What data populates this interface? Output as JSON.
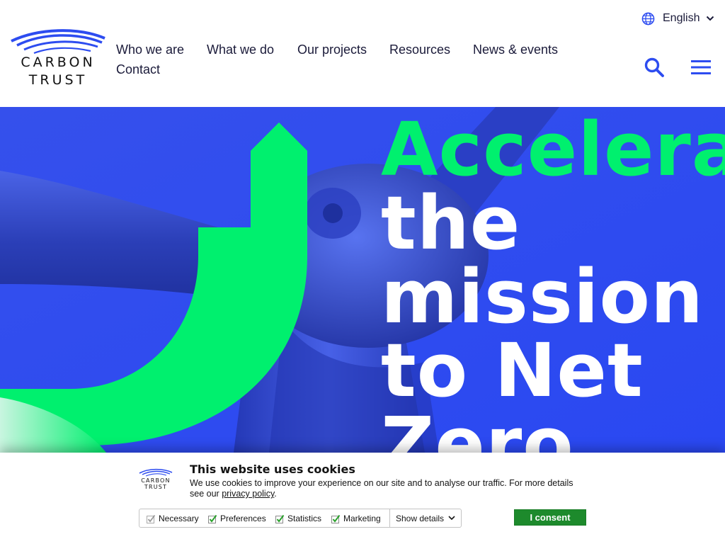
{
  "header": {
    "logo": {
      "line1": "CARBON",
      "line2": "TRUST"
    },
    "nav": [
      {
        "label": "Who we are"
      },
      {
        "label": "What we do"
      },
      {
        "label": "Our projects"
      },
      {
        "label": "Resources"
      },
      {
        "label": "News & events"
      },
      {
        "label": "Contact"
      }
    ],
    "language": {
      "label": "English",
      "icon": "globe-icon"
    },
    "search_icon": "search-icon",
    "menu_icon": "hamburger-menu-icon"
  },
  "hero": {
    "headline": {
      "line1": "Accelerating",
      "line2": "the",
      "line3": "mission",
      "line4": "to Net",
      "line5": "Zero"
    },
    "colors": {
      "background": "#2d4cf0",
      "accent": "#00f06e",
      "text": "#ffffff"
    }
  },
  "cookie_banner": {
    "logo": {
      "line1": "CARBON",
      "line2": "TRUST"
    },
    "title": "This website uses cookies",
    "text": "We use cookies to improve your experience on our site and to analyse our traffic. For more details see our",
    "link": "privacy policy",
    "text_end": ".",
    "checkboxes": [
      {
        "label": "Necessary",
        "checked": true,
        "disabled": true
      },
      {
        "label": "Preferences",
        "checked": true
      },
      {
        "label": "Statistics",
        "checked": true
      },
      {
        "label": "Marketing",
        "checked": true
      }
    ],
    "show_details": "Show details",
    "consent_button": "I consent",
    "colors": {
      "consent": "#1d8a2c",
      "check": "#2aa12c"
    }
  }
}
